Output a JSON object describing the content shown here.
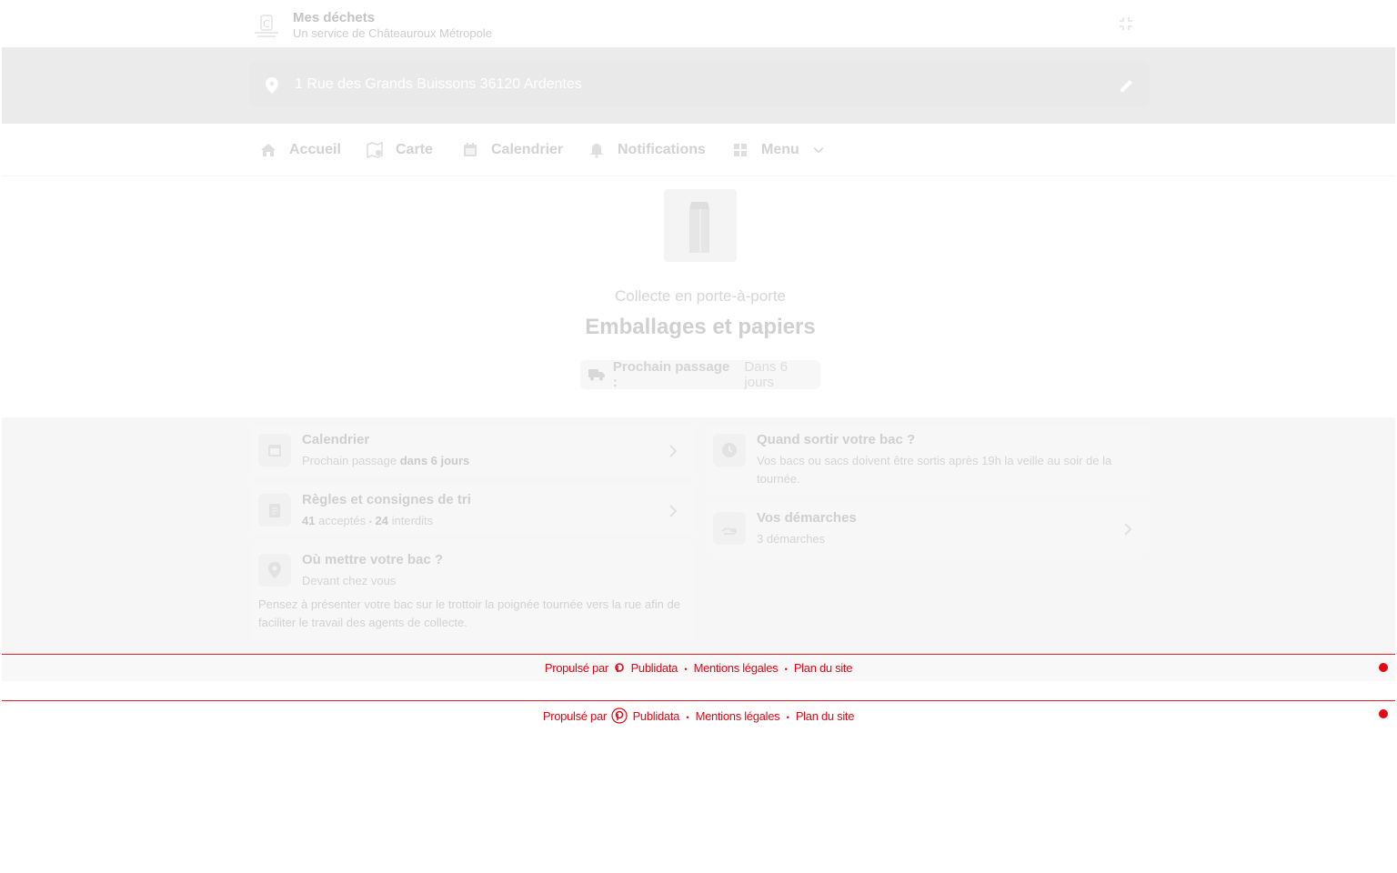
{
  "header": {
    "title": "Mes déchets",
    "subtitle": "Un service de Châteauroux Métropole",
    "logo_icon": "chateauroux-logo-icon",
    "collapse_icon": "fullscreen-exit-icon"
  },
  "address": {
    "pin_icon": "location-pin-icon",
    "text": "1 Rue des Grands Buissons 36120 Ardentes",
    "edit_icon": "pencil-icon"
  },
  "nav": {
    "items": [
      {
        "label": "Accueil",
        "icon": "home-icon"
      },
      {
        "label": "Carte",
        "icon": "map-icon"
      },
      {
        "label": "Calendrier",
        "icon": "calendar-icon"
      },
      {
        "label": "Notifications",
        "icon": "bell-icon"
      },
      {
        "label": "Menu",
        "icon": "grid-icon"
      }
    ]
  },
  "hero": {
    "icon": "waste-bin-icon",
    "subtitle": "Collecte en porte-à-porte",
    "title": "Emballages et papiers",
    "next_label": "Prochain passage :",
    "next_value": "Dans 6 jours"
  },
  "cards": {
    "calendar": {
      "title": "Calendrier",
      "sub_prefix": "Prochain passage",
      "sub_bold": "dans 6 jours"
    },
    "rules": {
      "title": "Règles et consignes de tri",
      "accepted_count": "41",
      "accepted_label": "acceptés",
      "sep": "•",
      "forbidden_count": "24",
      "forbidden_label": "interdits"
    },
    "where": {
      "title": "Où mettre votre bac ?",
      "sub": "Devant chez vous",
      "note": "Pensez à présenter votre bac sur le trottoir la poignée tournée vers la rue afin de faciliter le travail des agents de collecte."
    },
    "when": {
      "title": "Quand sortir votre bac ?",
      "sub": "Vos bacs ou sacs doivent être sortis après 19h la veille au soir de la tournée."
    },
    "procedures": {
      "title": "Vos démarches",
      "sub": "3 démarches"
    }
  },
  "footer": {
    "powered_by": "Propulsé par",
    "brand": "Publidata",
    "sep": "•",
    "legal": "Mentions légales",
    "sitemap": "Plan du site"
  },
  "colors": {
    "accent_red": "#e30613",
    "band_gray": "#ebebeb"
  }
}
